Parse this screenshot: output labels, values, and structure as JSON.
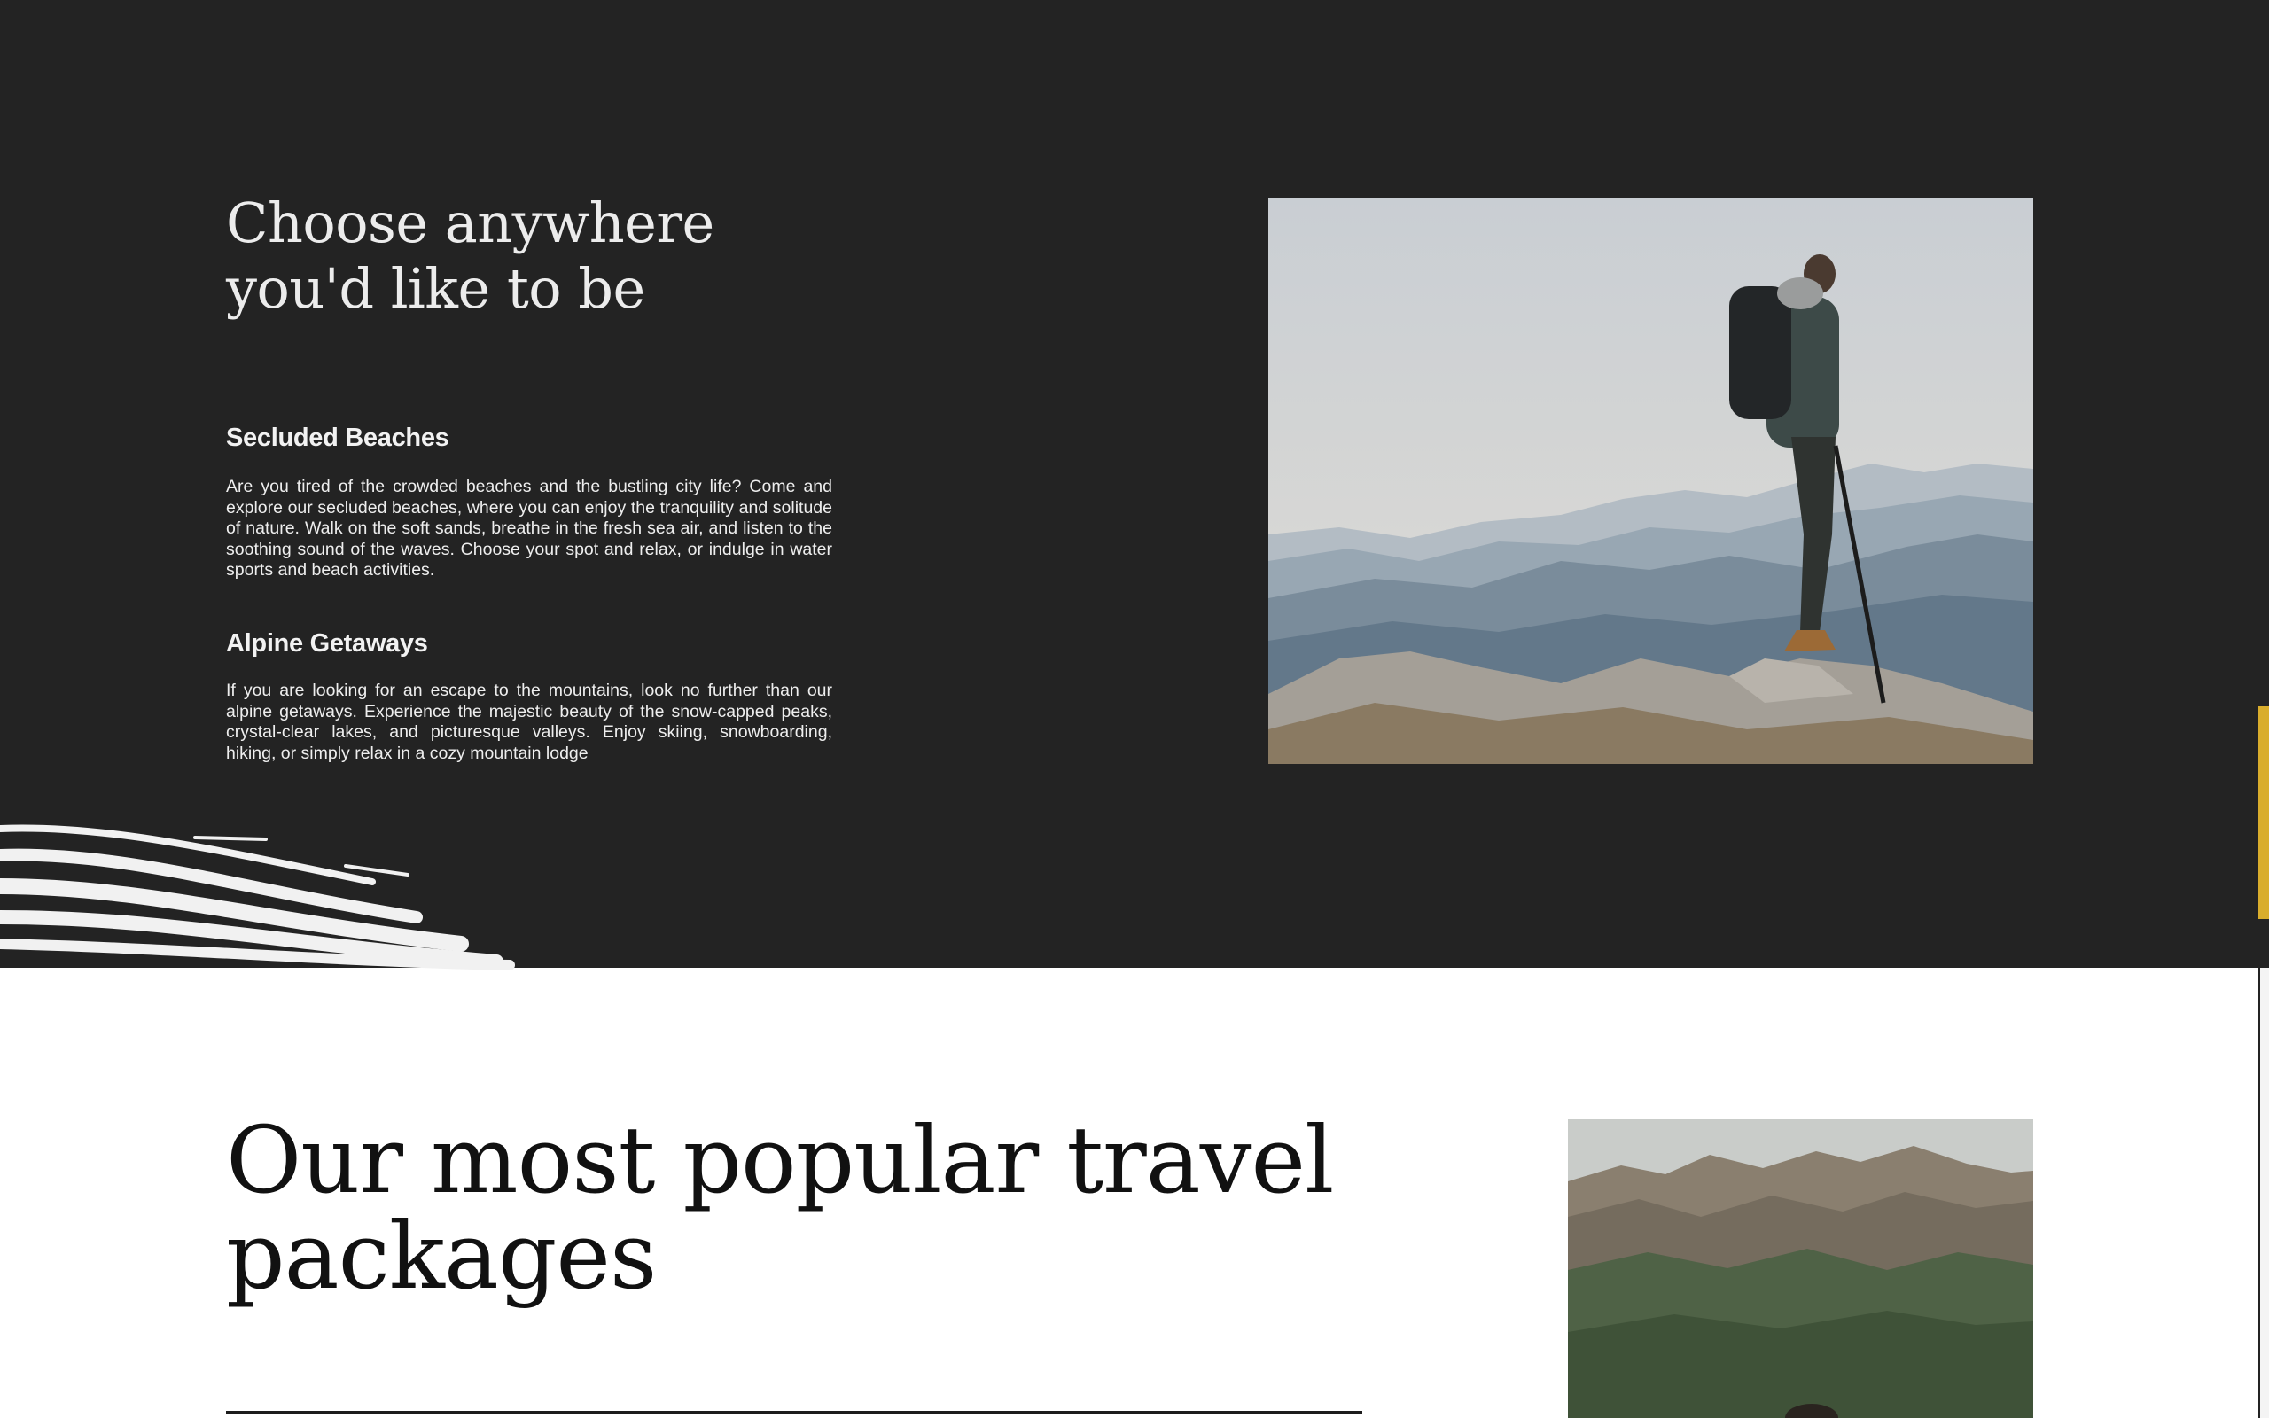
{
  "intro": {
    "title": "Choose anywhere you'd like to be",
    "features": [
      {
        "heading": "Secluded Beaches",
        "text": "Are you tired of the crowded beaches and the bustling city life? Come and explore our secluded beaches, where you can enjoy the tranquility and solitude of nature. Walk on the soft sands, breathe in the fresh sea air, and listen to the soothing sound of the waves. Choose your spot and relax, or indulge in water sports and beach activities."
      },
      {
        "heading": "Alpine Getaways",
        "text": "If you are looking for an escape to the mountains, look no further than our alpine getaways. Experience the majestic beauty of the snow-capped peaks, crystal-clear lakes, and picturesque valleys. Enjoy skiing, snowboarding, hiking, or simply relax in a cozy mountain lodge"
      }
    ],
    "image": "hiker-on-mountain-peak"
  },
  "packages": {
    "title": "Our most popular travel packages",
    "image": "green-mountain-range"
  },
  "colors": {
    "dark_bg": "#232323",
    "accent": "#d9ad2c",
    "light_bg": "#ffffff"
  }
}
